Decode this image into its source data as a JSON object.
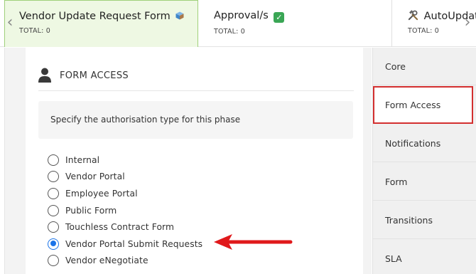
{
  "tabs": [
    {
      "title": "Vendor Update Request Form",
      "icon": "cube-icon",
      "total": "TOTAL: 0",
      "active": true
    },
    {
      "title": "Approval/s",
      "icon": "check-icon",
      "total": "TOTAL: 0",
      "active": false
    },
    {
      "title": "AutoUpdate",
      "icon": "tools-icon",
      "total": "TOTAL: 0",
      "active": false
    }
  ],
  "nav": {
    "left_icon": "chevron-left-icon",
    "right_icon": "chevron-right-icon",
    "left_glyph": "‹",
    "right_glyph": "›"
  },
  "section": {
    "title": "FORM ACCESS",
    "icon": "person-icon",
    "hint": "Specify the authorisation type for this phase"
  },
  "auth_options": [
    {
      "label": "Internal",
      "checked": false
    },
    {
      "label": "Vendor Portal",
      "checked": false
    },
    {
      "label": "Employee Portal",
      "checked": false
    },
    {
      "label": "Public Form",
      "checked": false
    },
    {
      "label": "Touchless Contract Form",
      "checked": false
    },
    {
      "label": "Vendor Portal Submit Requests",
      "checked": true
    },
    {
      "label": "Vendor eNegotiate",
      "checked": false
    }
  ],
  "sidebar": {
    "items": [
      {
        "label": "Core",
        "active": false
      },
      {
        "label": "Form Access",
        "active": true
      },
      {
        "label": "Notifications",
        "active": false
      },
      {
        "label": "Form",
        "active": false
      },
      {
        "label": "Transitions",
        "active": false
      },
      {
        "label": "SLA",
        "active": false
      }
    ]
  },
  "colors": {
    "active_tab_bg": "#eef8e3",
    "active_tab_border": "#9fd07a",
    "highlight_red": "#d32f2f",
    "radio_checked": "#1a73e8",
    "annotation_arrow": "#e0191b"
  }
}
